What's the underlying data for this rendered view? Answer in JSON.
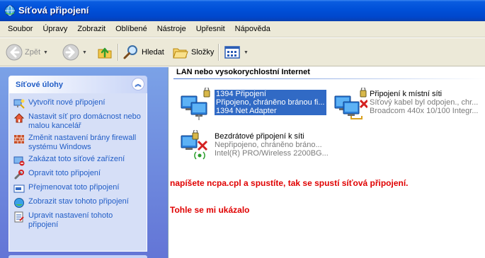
{
  "window": {
    "title": "Síťová připojení"
  },
  "menu": [
    "Soubor",
    "Úpravy",
    "Zobrazit",
    "Oblíbené",
    "Nástroje",
    "Upřesnit",
    "Nápověda"
  ],
  "toolbar": {
    "back_label": "Zpět",
    "search_label": "Hledat",
    "folders_label": "Složky"
  },
  "tasks": {
    "title": "Síťové úlohy",
    "items": [
      {
        "label": "Vytvořit nové připojení",
        "icon": "new-connection-icon"
      },
      {
        "label": "Nastavit síť pro domácnost nebo malou kancelář",
        "icon": "home-network-icon"
      },
      {
        "label": "Změnit nastavení brány firewall systému Windows",
        "icon": "firewall-icon"
      },
      {
        "label": "Zakázat toto síťové zařízení",
        "icon": "disable-icon"
      },
      {
        "label": "Opravit toto připojení",
        "icon": "repair-icon"
      },
      {
        "label": "Přejmenovat toto připojení",
        "icon": "rename-icon"
      },
      {
        "label": "Zobrazit stav tohoto připojení",
        "icon": "status-icon"
      },
      {
        "label": "Upravit nastavení tohoto připojení",
        "icon": "properties-icon"
      }
    ]
  },
  "content": {
    "group_title": "LAN nebo vysokorychlostní Internet",
    "connections": [
      {
        "name": "1394 Připojení",
        "status": "Připojeno, chráněno bránou fi...",
        "device": "1394 Net Adapter",
        "selected": true,
        "icon": "network-connection-icon"
      },
      {
        "name": "Připojení k místní síti",
        "status": "Síťový kabel byl odpojen., chr...",
        "device": "Broadcom 440x 10/100 Integr...",
        "selected": false,
        "icon": "network-disconnected-icon"
      },
      {
        "name": "Bezdrátové připojení k síti",
        "status": "Nepřipojeno, chráněno bráno...",
        "device": "Intel(R) PRO/Wireless 2200BG...",
        "selected": false,
        "icon": "wireless-disconnected-icon"
      }
    ]
  },
  "notes": [
    "napíšete ncpa.cpl a spustíte, tak se spustí síťová připojení.",
    "Tohle se mi ukázalo"
  ],
  "colors": {
    "titlebar": "#0050d8",
    "task_link": "#215dc6",
    "note": "#e00000",
    "selection": "#316ac5"
  }
}
